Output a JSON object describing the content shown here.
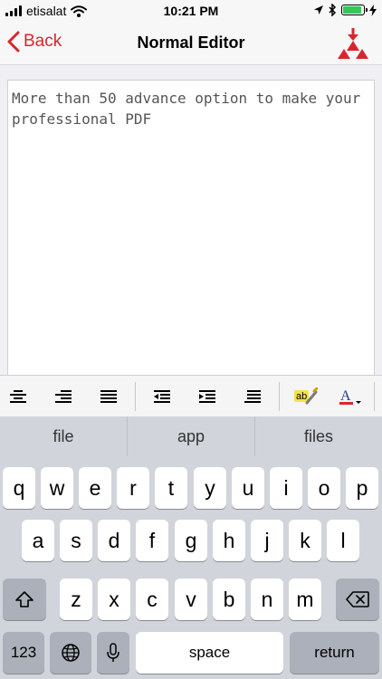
{
  "status_bar": {
    "carrier": "etisalat",
    "time": "10:21 PM",
    "battery_level": 0.9
  },
  "nav": {
    "back_label": "Back",
    "title": "Normal Editor",
    "action_icon": "pdf-merge-icon",
    "accent_color": "#d7272e"
  },
  "editor": {
    "text": "More than 50 advance option to make your professional PDF"
  },
  "toolbar": {
    "buttons": [
      "align-center-icon",
      "align-right-icon",
      "align-justify-icon",
      "outdent-icon",
      "indent-icon",
      "list-icon",
      "spellcheck-icon",
      "font-color-icon"
    ],
    "spellcheck_label": "ab",
    "font_color_label": "A"
  },
  "keyboard": {
    "suggestions": [
      "file",
      "app",
      "files"
    ],
    "row1": [
      "q",
      "w",
      "e",
      "r",
      "t",
      "y",
      "u",
      "i",
      "o",
      "p"
    ],
    "row2": [
      "a",
      "s",
      "d",
      "f",
      "g",
      "h",
      "j",
      "k",
      "l"
    ],
    "row3": [
      "z",
      "x",
      "c",
      "v",
      "b",
      "n",
      "m"
    ],
    "numbers_label": "123",
    "space_label": "space",
    "return_label": "return"
  }
}
